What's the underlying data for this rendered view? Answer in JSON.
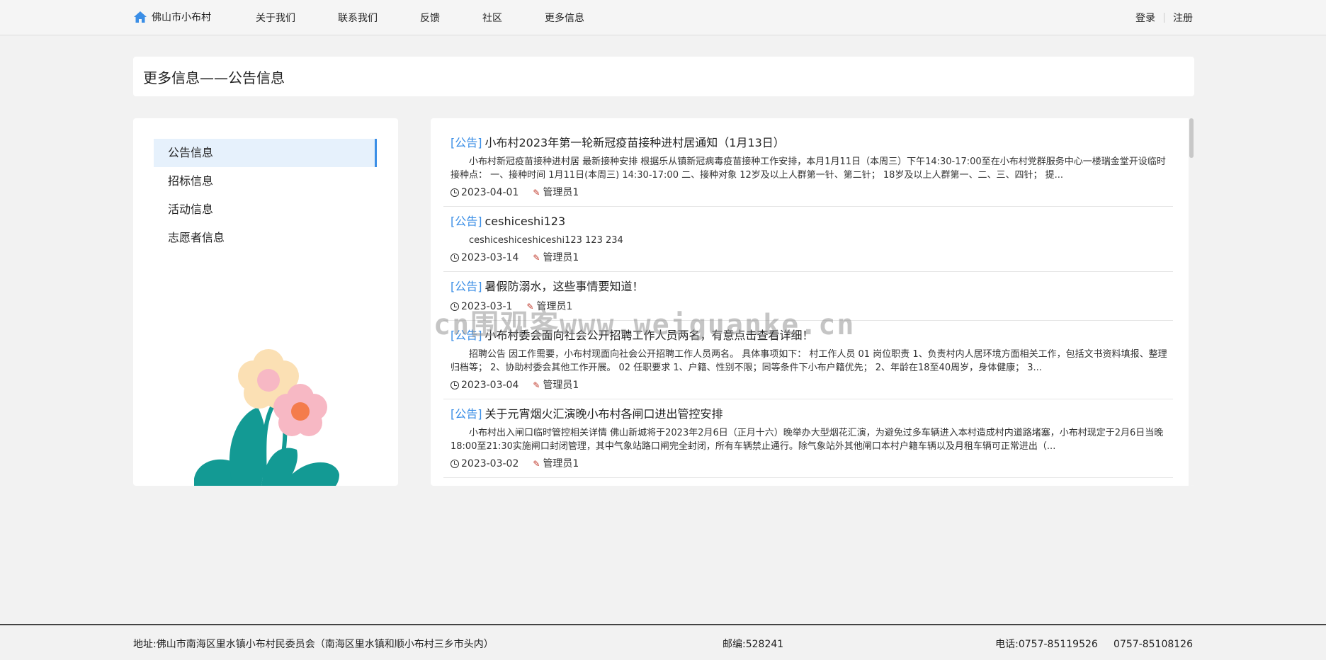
{
  "header": {
    "brand": "佛山市小布村",
    "nav": [
      "关于我们",
      "联系我们",
      "反馈",
      "社区",
      "更多信息"
    ],
    "login": "登录",
    "register": "注册"
  },
  "page_title": "更多信息——公告信息",
  "sidebar": {
    "items": [
      "公告信息",
      "招标信息",
      "活动信息",
      "志愿者信息"
    ],
    "active_index": 0
  },
  "news": [
    {
      "tag": "[公告]",
      "title": "小布村2023年第一轮新冠疫苗接种进村居通知（1月13日）",
      "summary": "小布村新冠疫苗接种进村居 最新接种安排 根据乐从镇新冠病毒疫苗接种工作安排，本月1月11日（本周三）下午14:30-17:00至在小布村党群服务中心一楼瑞金堂开设临时接种点： 一、接种时间 1月11日(本周三) 14:30-17:00 二、接种对象 12岁及以上人群第一针、第二针； 18岁及以上人群第一、二、三、四针； 提...",
      "date": "2023-04-01",
      "author": "管理员1"
    },
    {
      "tag": "[公告]",
      "title": "ceshiceshi123",
      "summary": "ceshiceshiceshiceshi123 123 234",
      "date": "2023-03-14",
      "author": "管理员1"
    },
    {
      "tag": "[公告]",
      "title": "暑假防溺水，这些事情要知道！",
      "summary": "",
      "date": "2023-03-1",
      "author": "管理员1"
    },
    {
      "tag": "[公告]",
      "title": "小布村委会面向社会公开招聘工作人员两名，有意点击查看详细！",
      "summary": "招聘公告 因工作需要，小布村现面向社会公开招聘工作人员两名。 具体事项如下： 村工作人员 01 岗位职责 1、负责村内人居环境方面相关工作，包括文书资料填报、整理归档等； 2、协助村委会其他工作开展。 02 任职要求 1、户籍、性别不限；同等条件下小布户籍优先； 2、年龄在18至40周岁，身体健康； 3...",
      "date": "2023-03-04",
      "author": "管理员1"
    },
    {
      "tag": "[公告]",
      "title": "关于元宵烟火汇演晚小布村各闸口进出管控安排",
      "summary": "小布村出入闸口临时管控相关详情 佛山新城将于2023年2月6日（正月十六）晚举办大型烟花汇演，为避免过多车辆进入本村造成村内道路堵塞，小布村现定于2月6日当晚18:00至21:30实施闸口封闭管理，其中气象站路口闸完全封闭，所有车辆禁止通行。除气象站外其他闸口本村户籍车辆以及月租车辆可正常进出（...",
      "date": "2023-03-02",
      "author": "管理员1"
    }
  ],
  "watermark": "cn围观客www.weiguanke.cn",
  "footer": {
    "address": "地址:佛山市南海区里水镇小布村民委员会（南海区里水镇和顺小布村三乡市头内）",
    "zip": "邮编:528241",
    "phone": "电话:0757-85119526     0757-85108126"
  },
  "colors": {
    "accent": "#3a8ee6",
    "active_bg": "#e6f1fc",
    "flower_leaf": "#139a94",
    "flower_pink": "#f7b8c4",
    "flower_cream": "#fbe0b4",
    "flower_center": "#f47c4c"
  }
}
